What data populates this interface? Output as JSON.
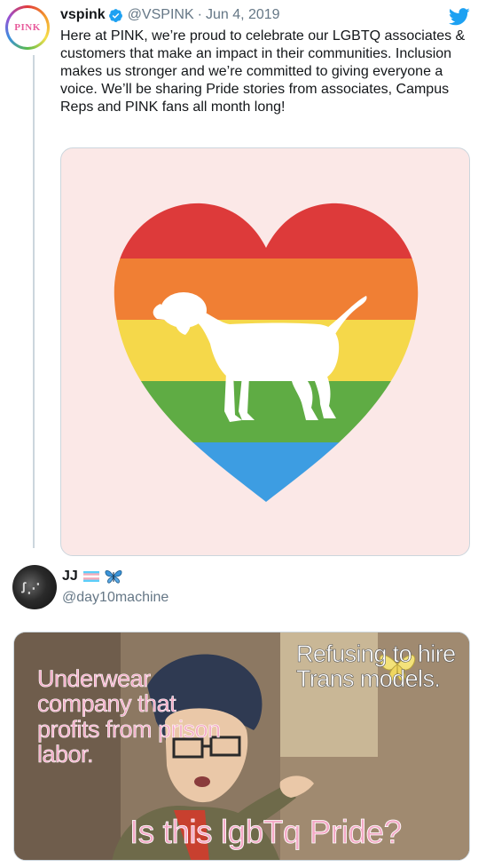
{
  "tweet": {
    "avatar_logo": "PINK",
    "display_name": "vspink",
    "handle": "@VSPINK",
    "separator": "·",
    "date": "Jun 4, 2019",
    "text": "Here at PINK, we’re proud to celebrate our LGBTQ associates & customers that make an impact in their communities. Inclusion makes us stronger and we’re committed to giving everyone a voice. We’ll be sharing Pride stories from associates, Campus Reps and PINK fans all month long!",
    "media": {
      "image": "rainbow-heart-dog-silhouette",
      "stripe_colors": [
        "#dd3a3a",
        "#f07f34",
        "#f5d84a",
        "#5fac44",
        "#3d9de2"
      ],
      "background_color": "#fbe8e7"
    }
  },
  "reply": {
    "display_name": "JJ",
    "emoji": [
      "transgender-flag",
      "butterfly"
    ],
    "handle": "@day10machine",
    "meme": {
      "template": "is-this-a-pigeon",
      "left_caption": "Underwear company that profits from prison labor.",
      "right_caption": "Refusing to hire Trans models.",
      "bottom_caption": "Is this lgbTq Pride?",
      "caption_pink": "#f4a9c6"
    }
  },
  "colors": {
    "text_primary": "#14171a",
    "text_secondary": "#657786",
    "twitter_blue": "#1da1f2",
    "border": "#ccd6dd"
  }
}
